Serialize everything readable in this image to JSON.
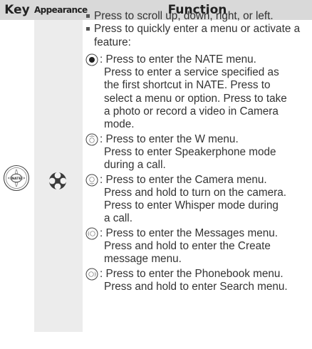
{
  "header": {
    "key": "Key",
    "appearance": "Appearance",
    "function": "Function"
  },
  "icons": {
    "key": "navigation-key-icon",
    "appearance": "navigation-dpad-icon"
  },
  "bullets": [
    "Press to scroll up, down, right, or left.",
    "Press to quickly enter a menu or activate a feature:"
  ],
  "entries": [
    {
      "icon": "center-ok-key-icon",
      "first": ": Press to enter the NATE menu.",
      "rest": [
        "Press to enter a service specified as",
        "the first shortcut in NATE. Press to",
        "select a menu or option. Press to take",
        "a photo or record a video in Camera",
        "mode."
      ]
    },
    {
      "icon": "up-key-icon",
      "first": ": Press to enter the W menu.",
      "rest": [
        "Press to enter Speakerphone mode",
        "during a call."
      ]
    },
    {
      "icon": "down-key-icon",
      "first": ": Press to enter the Camera menu.",
      "rest": [
        "Press and hold to turn on the camera.",
        "Press to enter Whisper mode during",
        "a call."
      ]
    },
    {
      "icon": "left-key-icon",
      "first": ": Press to enter the Messages menu.",
      "rest": [
        "Press and hold to enter the Create",
        "message menu."
      ]
    },
    {
      "icon": "right-key-icon",
      "first": ": Press to enter the Phonebook menu.",
      "rest": [
        "Press and hold to enter Search menu."
      ]
    }
  ]
}
